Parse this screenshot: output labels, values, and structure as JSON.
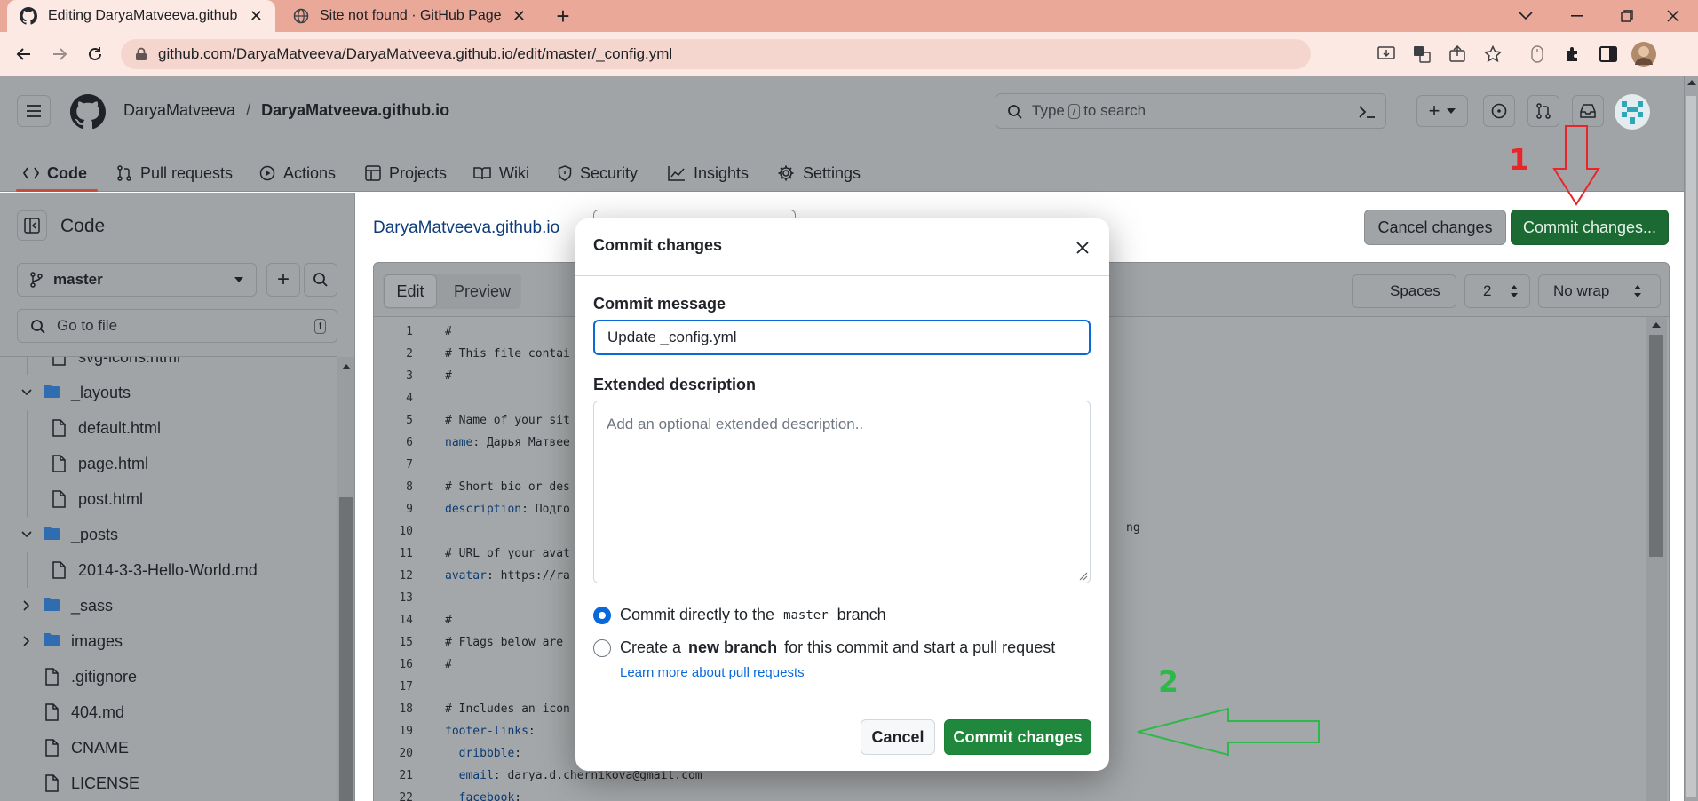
{
  "browser": {
    "tabs": [
      {
        "title": "Editing DaryaMatveeva.github.io/"
      },
      {
        "title": "Site not found · GitHub Pages"
      }
    ],
    "url": "github.com/DaryaMatveeva/DaryaMatveeva.github.io/edit/master/_config.yml"
  },
  "header": {
    "owner": "DaryaMatveeva",
    "separator": "/",
    "repo": "DaryaMatveeva.github.io",
    "search_prefix": "Type",
    "search_key": "/",
    "search_suffix": "to search"
  },
  "repo_nav": [
    "Code",
    "Pull requests",
    "Actions",
    "Projects",
    "Wiki",
    "Security",
    "Insights",
    "Settings"
  ],
  "sidebar": {
    "title": "Code",
    "branch": "master",
    "goto_placeholder": "Go to file",
    "goto_key": "t",
    "tree": [
      {
        "name": "svg-icons.html",
        "type": "file",
        "level": 1
      },
      {
        "name": "_layouts",
        "type": "folder-open",
        "level": 0
      },
      {
        "name": "default.html",
        "type": "file",
        "level": 1
      },
      {
        "name": "page.html",
        "type": "file",
        "level": 1
      },
      {
        "name": "post.html",
        "type": "file",
        "level": 1
      },
      {
        "name": "_posts",
        "type": "folder-open",
        "level": 0
      },
      {
        "name": "2014-3-3-Hello-World.md",
        "type": "file",
        "level": 1
      },
      {
        "name": "_sass",
        "type": "folder",
        "level": 0
      },
      {
        "name": "images",
        "type": "folder",
        "level": 0
      },
      {
        "name": ".gitignore",
        "type": "file",
        "level": 0
      },
      {
        "name": "404.md",
        "type": "file",
        "level": 0
      },
      {
        "name": "CNAME",
        "type": "file",
        "level": 0
      },
      {
        "name": "LICENSE",
        "type": "file",
        "level": 0
      }
    ]
  },
  "editor": {
    "breadcrumb": "DaryaMatveeva.github.io",
    "tabs": [
      "Edit",
      "Preview"
    ],
    "indent_mode": "Spaces",
    "indent_size": "2",
    "wrap_mode": "No wrap",
    "cancel_label": "Cancel changes",
    "commit_label": "Commit changes...",
    "lines": [
      {
        "n": "1",
        "key": "",
        "text": "#"
      },
      {
        "n": "2",
        "key": "",
        "text": "# This file contai"
      },
      {
        "n": "3",
        "key": "",
        "text": "#"
      },
      {
        "n": "4",
        "key": "",
        "text": ""
      },
      {
        "n": "5",
        "key": "",
        "text": "# Name of your sit"
      },
      {
        "n": "6",
        "key": "name",
        "text": ": Дарья Матвее"
      },
      {
        "n": "7",
        "key": "",
        "text": ""
      },
      {
        "n": "8",
        "key": "",
        "text": "# Short bio or des"
      },
      {
        "n": "9",
        "key": "description",
        "text": ": Подго"
      },
      {
        "n": "10",
        "key": "",
        "text": ""
      },
      {
        "n": "11",
        "key": "",
        "text": "# URL of your avat"
      },
      {
        "n": "12",
        "key": "avatar",
        "text": ": https://ra"
      },
      {
        "n": "13",
        "key": "",
        "text": ""
      },
      {
        "n": "14",
        "key": "",
        "text": "#"
      },
      {
        "n": "15",
        "key": "",
        "text": "# Flags below are"
      },
      {
        "n": "16",
        "key": "",
        "text": "#"
      },
      {
        "n": "17",
        "key": "",
        "text": ""
      },
      {
        "n": "18",
        "key": "",
        "text": "# Includes an icon"
      },
      {
        "n": "19",
        "key": "footer-links",
        "text": ":"
      },
      {
        "n": "20",
        "key": "  dribbble",
        "text": ":"
      },
      {
        "n": "21",
        "key": "  email",
        "text": ": darya.d.chernikova@gmail.com"
      },
      {
        "n": "22",
        "key": "  facebook",
        "text": ":"
      }
    ],
    "line12_tail": "ng"
  },
  "modal": {
    "title": "Commit changes",
    "message_label": "Commit message",
    "message_value": "Update _config.yml",
    "description_label": "Extended description",
    "description_placeholder": "Add an optional extended description..",
    "option1_prefix": "Commit directly to the",
    "option1_branch": "master",
    "option1_suffix": "branch",
    "option2_prefix": "Create a",
    "option2_bold": "new branch",
    "option2_suffix": "for this commit and start a pull request",
    "learn_more": "Learn more about pull requests",
    "cancel_label": "Cancel",
    "commit_label": "Commit changes"
  },
  "annotations": {
    "step1": "1",
    "step2": "2",
    "step1_color": "#e8262a",
    "step2_color": "#2fb84a"
  }
}
